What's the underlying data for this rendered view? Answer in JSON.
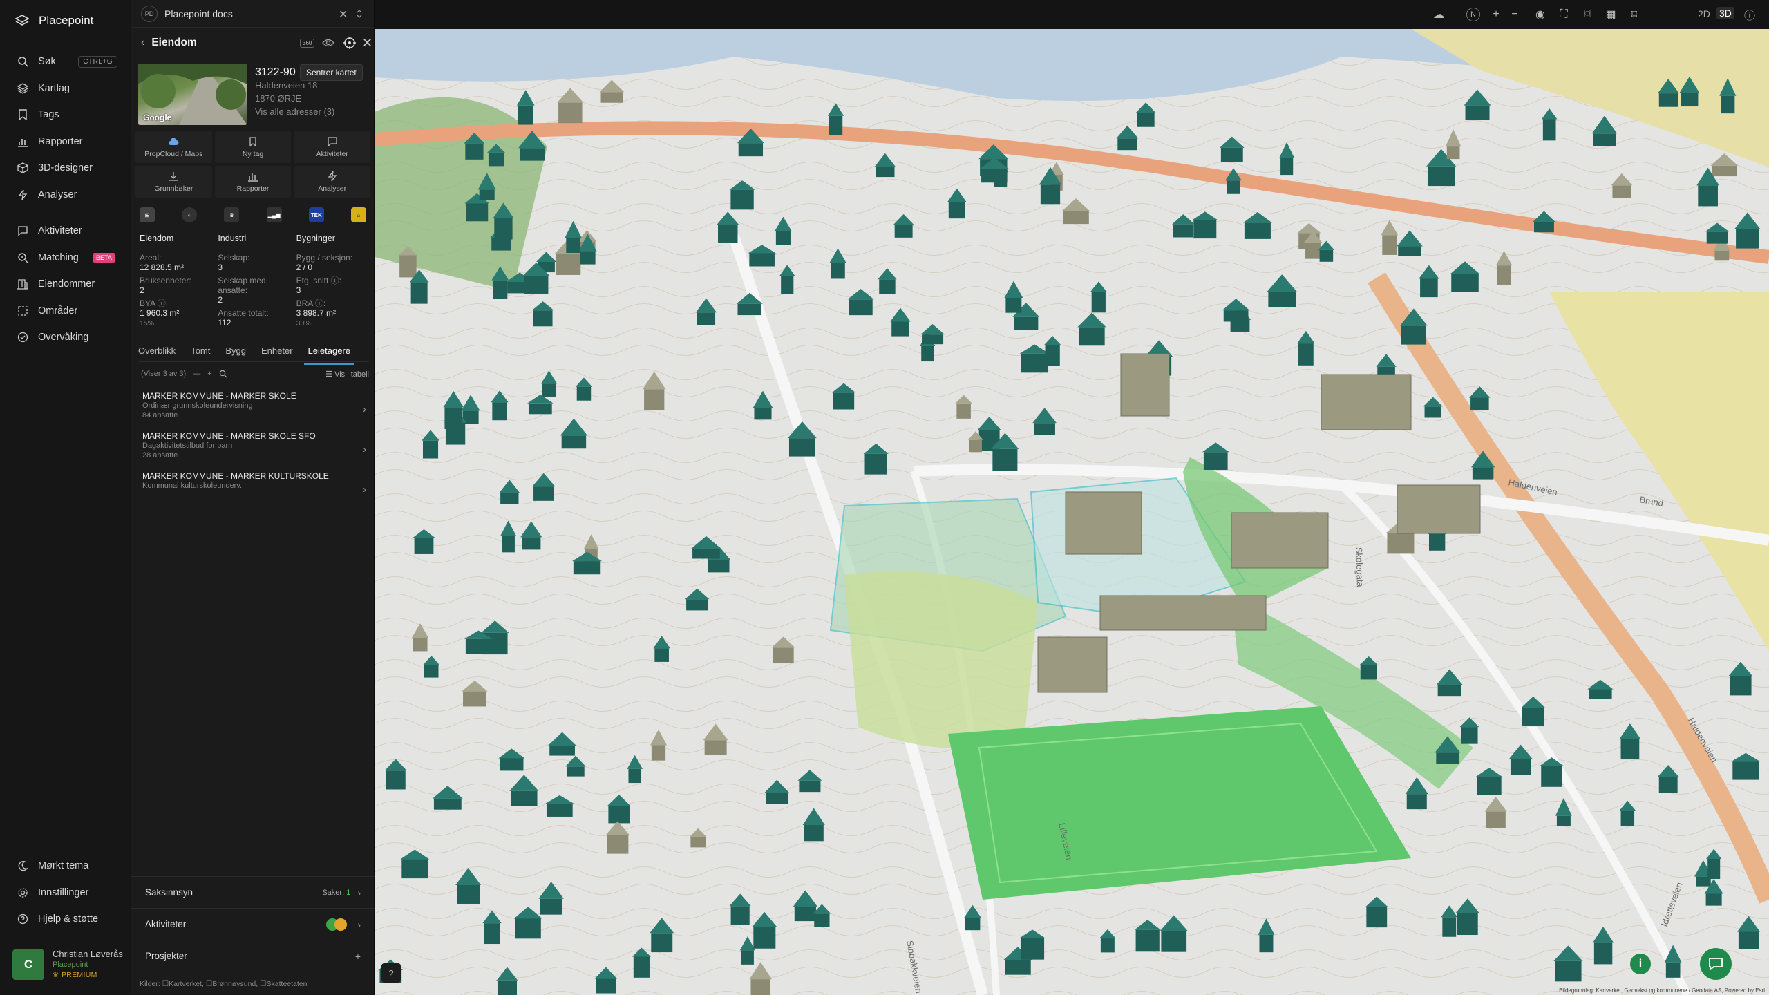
{
  "app": {
    "name": "Placepoint"
  },
  "nav": {
    "search": {
      "label": "Søk",
      "shortcut": "CTRL+G"
    },
    "main": [
      {
        "label": "Kartlag",
        "icon": "layers-icon"
      },
      {
        "label": "Tags",
        "icon": "bookmark-icon"
      },
      {
        "label": "Rapporter",
        "icon": "bar-chart-icon"
      },
      {
        "label": "3D-designer",
        "icon": "cube-icon"
      },
      {
        "label": "Analyser",
        "icon": "bolt-icon"
      }
    ],
    "secondary": [
      {
        "label": "Aktiviteter",
        "icon": "message-icon"
      },
      {
        "label": "Matching",
        "icon": "match-icon",
        "badge": "BETA"
      },
      {
        "label": "Eiendommer",
        "icon": "building-icon"
      },
      {
        "label": "Områder",
        "icon": "area-icon"
      },
      {
        "label": "Overvåking",
        "icon": "monitor-icon"
      }
    ],
    "bottom": [
      {
        "label": "Mørkt tema",
        "icon": "moon-icon"
      },
      {
        "label": "Innstillinger",
        "icon": "gear-icon"
      },
      {
        "label": "Hjelp & støtte",
        "icon": "help-icon"
      }
    ]
  },
  "user": {
    "initial": "C",
    "name": "Christian Løverås",
    "org": "Placepoint",
    "plan": "PREMIUM"
  },
  "tab": {
    "badge": "PD",
    "title": "Placepoint docs"
  },
  "panel": {
    "title": "Eiendom",
    "tag_360": "360",
    "tooltip": "Sentrer kartet",
    "image_tag": "Google",
    "prop_id": "3122-90",
    "address": "Haldenveien 18",
    "postal": "1870 ØRJE",
    "all_addresses": "Vis alle adresser (3)",
    "actions": [
      {
        "label": "PropCloud / Maps",
        "icon": "cloud-icon"
      },
      {
        "label": "Ny tag",
        "icon": "bookmark-icon"
      },
      {
        "label": "Aktiviteter",
        "icon": "message-icon"
      },
      {
        "label": "Grunnbøker",
        "icon": "download-icon"
      },
      {
        "label": "Rapporter",
        "icon": "bar-chart-icon"
      },
      {
        "label": "Analyser",
        "icon": "bolt-icon"
      }
    ],
    "tek_label": "TEK",
    "stats": {
      "eiendom": {
        "title": "Eiendom",
        "areal_label": "Areal:",
        "areal": "12 828.5 m²",
        "bruk_label": "Bruksenheter:",
        "bruk": "2",
        "bya_label": "BYA ⓘ:",
        "bya": "1 960.3 m²",
        "bya_pct": "15%"
      },
      "industri": {
        "title": "Industri",
        "selskap_label": "Selskap:",
        "selskap": "3",
        "ansatte_label": "Selskap med ansatte:",
        "ansatte": "2",
        "totalt_label": "Ansatte totalt:",
        "totalt": "112"
      },
      "bygninger": {
        "title": "Bygninger",
        "bygg_label": "Bygg / seksjon:",
        "bygg": "2 / 0",
        "etg_label": "Etg. snitt ⓘ:",
        "etg": "3",
        "bra_label": "BRA ⓘ:",
        "bra": "3 898.7 m²",
        "bra_pct": "30%"
      }
    },
    "tabs": [
      "Overblikk",
      "Tomt",
      "Bygg",
      "Enheter",
      "Leietagere"
    ],
    "active_tab": "Leietagere",
    "list_count": "(Viser 3 av 3)",
    "list_view": "Vis i tabell",
    "tenants": [
      {
        "name": "MARKER KOMMUNE - MARKER SKOLE",
        "desc": "Ordinær grunnskoleundervisning",
        "emp": "84 ansatte"
      },
      {
        "name": "MARKER KOMMUNE - MARKER SKOLE SFO",
        "desc": "Dagaktivitetstilbud for barn",
        "emp": "28 ansatte"
      },
      {
        "name": "MARKER KOMMUNE - MARKER KULTURSKOLE",
        "desc": "Kommunal kulturskoleunderv.",
        "emp": ""
      }
    ],
    "saksinnsyn": {
      "label": "Saksinnsyn",
      "saker_label": "Saker:",
      "saker": "1"
    },
    "aktiviteter": {
      "label": "Aktiviteter"
    },
    "prosjekter": {
      "label": "Prosjekter"
    },
    "sources": {
      "label": "Kilder:",
      "items": [
        "Kartverket,",
        "Brønnøysund,",
        "Skatteetaten"
      ]
    }
  },
  "map": {
    "view_2d": "2D",
    "view_3d": "3D",
    "compass": "N",
    "street_labels": [
      "Haldenveien",
      "Haldenveien",
      "Lilleveien",
      "Skolegata",
      "Idrettsveien",
      "Sibbakkveien",
      "Brand"
    ],
    "attribution": "Bildegrunnlag: Kartverket, Geovekst og kommunene / Geodata AS, Powered by Esri"
  },
  "colors": {
    "accent": "#3e97d1",
    "building": "#1f5f57",
    "building_old": "#8c8a72",
    "field": "#63c66f",
    "water": "#b9cfe0"
  }
}
